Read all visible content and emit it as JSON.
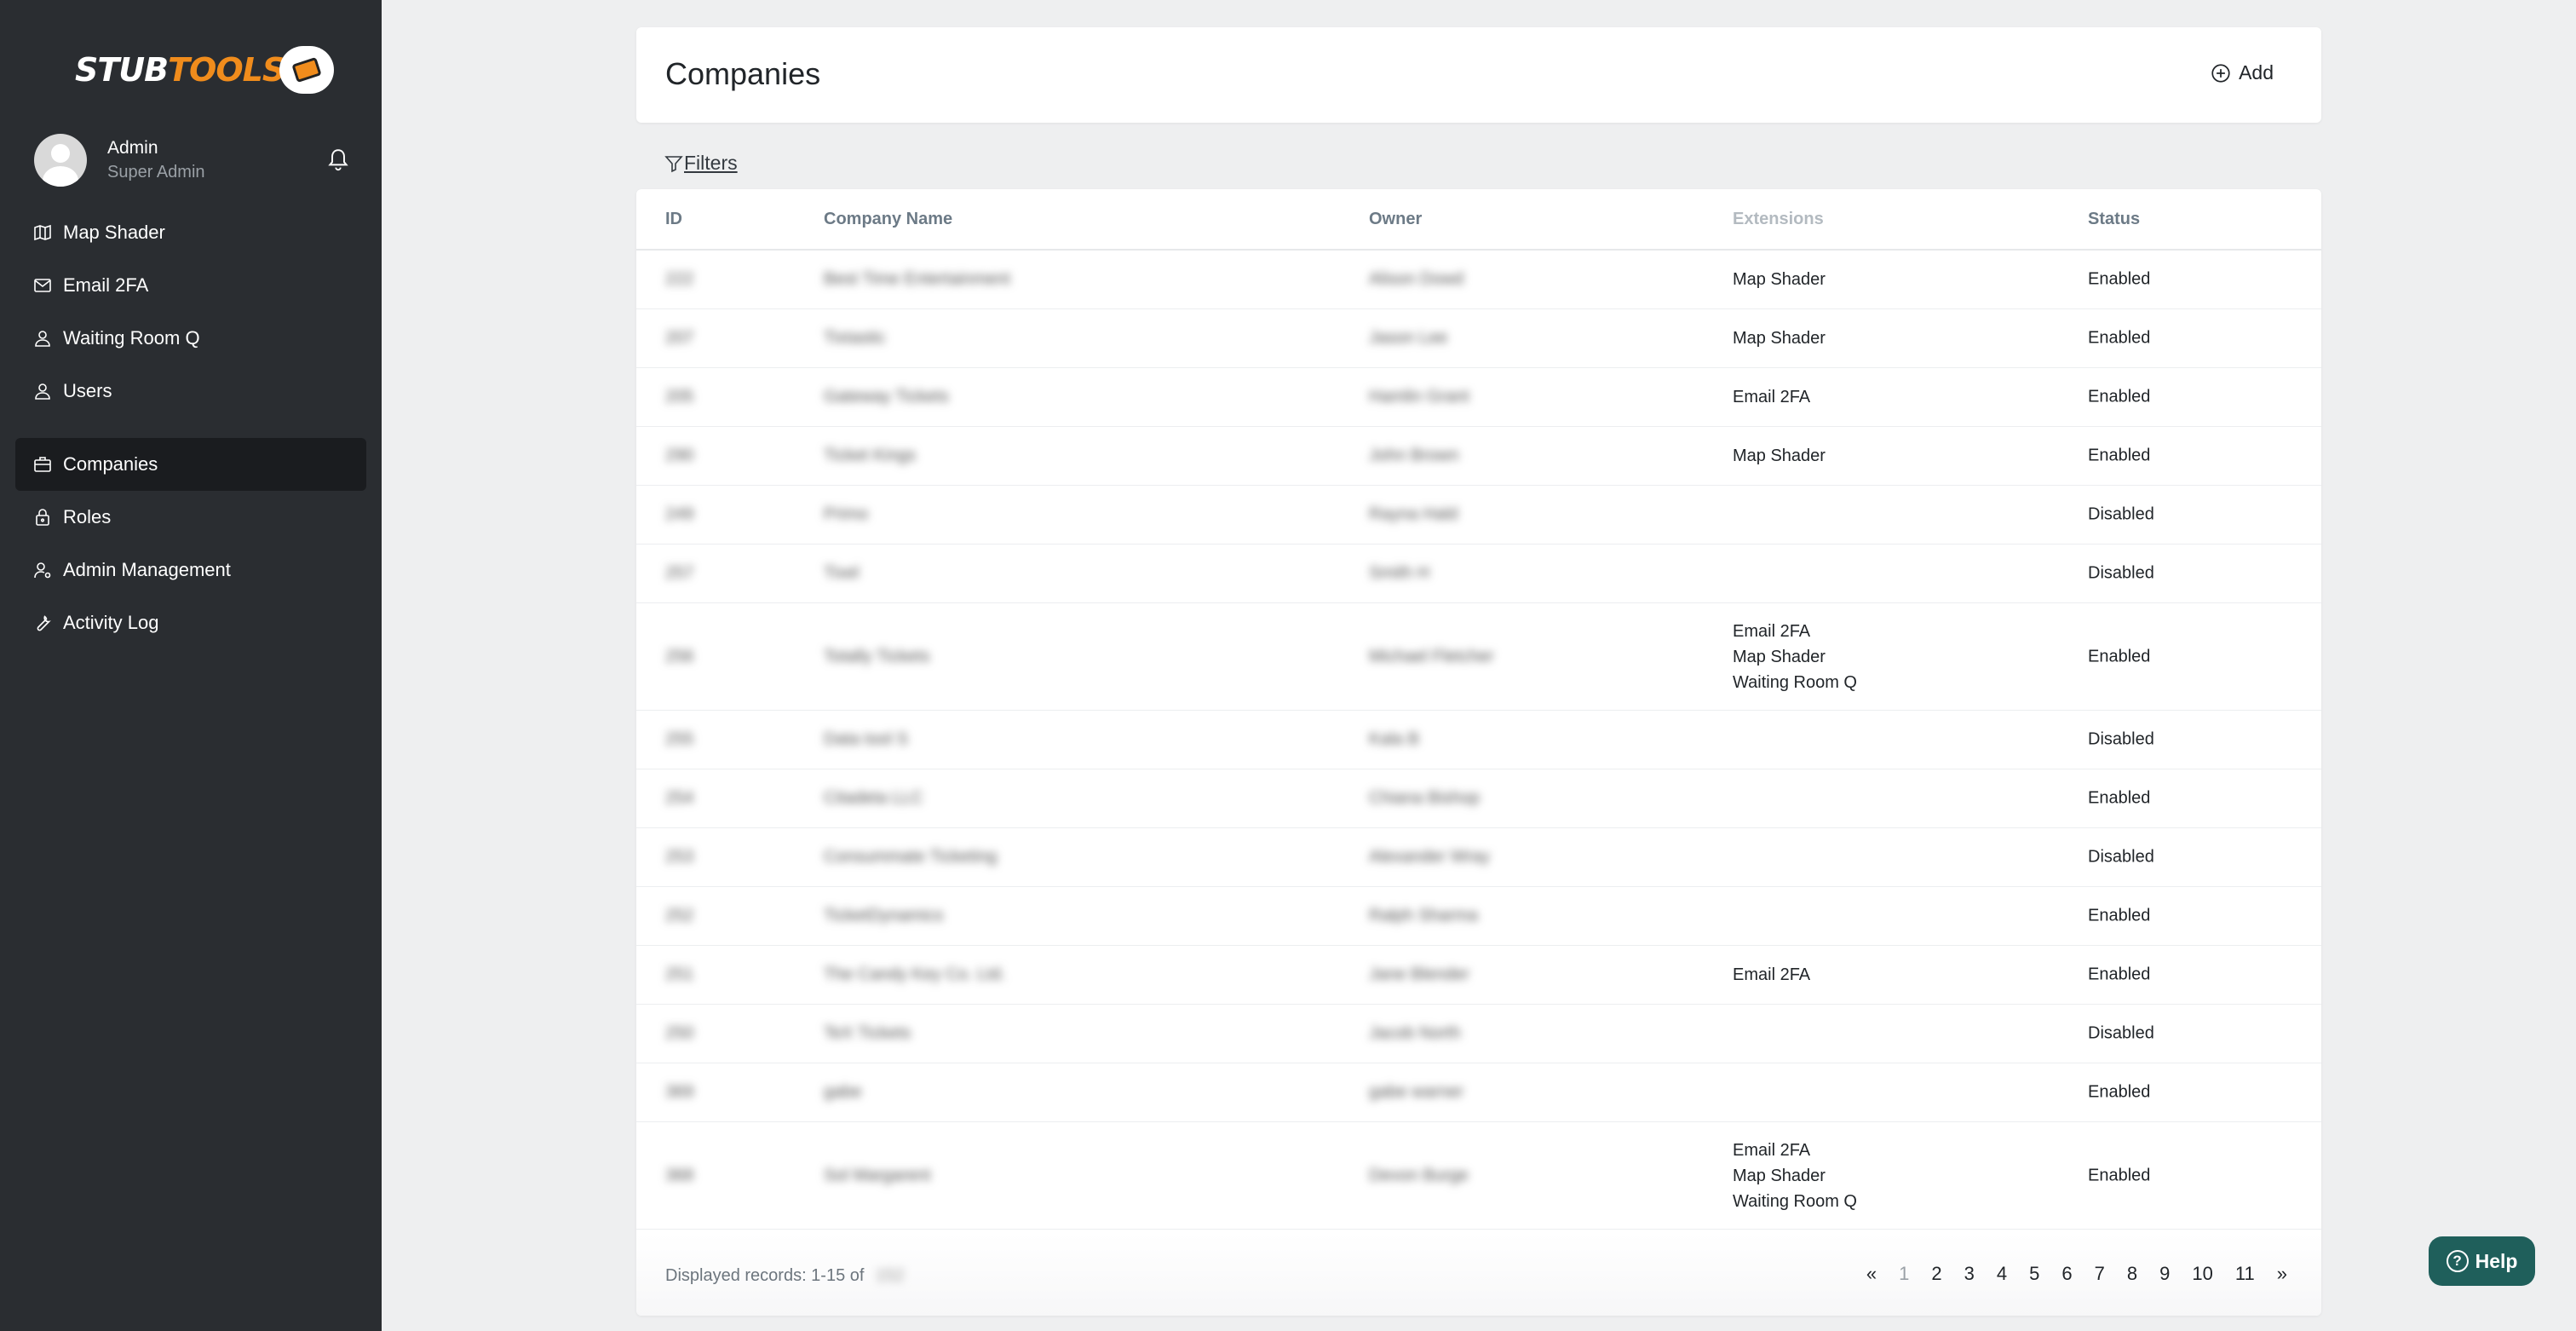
{
  "app": {
    "logo_part1": "STUB",
    "logo_part2": "TOOLS"
  },
  "profile": {
    "name": "Admin",
    "role": "Super Admin"
  },
  "sidebar": {
    "items": [
      {
        "label": "Map Shader",
        "icon": "map-icon"
      },
      {
        "label": "Email 2FA",
        "icon": "mail-icon"
      },
      {
        "label": "Waiting Room Q",
        "icon": "user-icon"
      },
      {
        "label": "Users",
        "icon": "user-icon"
      },
      {
        "label": "Companies",
        "icon": "briefcase-icon",
        "active": true
      },
      {
        "label": "Roles",
        "icon": "lock-icon"
      },
      {
        "label": "Admin Management",
        "icon": "user-cog-icon"
      },
      {
        "label": "Activity Log",
        "icon": "wrench-icon"
      }
    ]
  },
  "header": {
    "title": "Companies",
    "add_label": "Add"
  },
  "filters": {
    "label": "Filters"
  },
  "table": {
    "columns": [
      "ID",
      "Company Name",
      "Owner",
      "Extensions",
      "Status"
    ],
    "rows": [
      {
        "id": "222",
        "name": "Best Time Entertainment",
        "owner": "Alison Dowd",
        "extensions": [
          "Map Shader"
        ],
        "status": "Enabled"
      },
      {
        "id": "207",
        "name": "Tixtastic",
        "owner": "Jason Lee",
        "extensions": [
          "Map Shader"
        ],
        "status": "Enabled"
      },
      {
        "id": "205",
        "name": "Gateway Tickets",
        "owner": "Hamlin Grant",
        "extensions": [
          "Email 2FA"
        ],
        "status": "Enabled"
      },
      {
        "id": "290",
        "name": "Ticket Kings",
        "owner": "John Brown",
        "extensions": [
          "Map Shader"
        ],
        "status": "Enabled"
      },
      {
        "id": "249",
        "name": "Primo",
        "owner": "Rayna Hald",
        "extensions": [],
        "status": "Disabled"
      },
      {
        "id": "257",
        "name": "Tixel",
        "owner": "Smith H",
        "extensions": [],
        "status": "Disabled"
      },
      {
        "id": "256",
        "name": "Totally Tickets",
        "owner": "Michael Fletcher",
        "extensions": [
          "Email 2FA",
          "Map Shader",
          "Waiting Room Q"
        ],
        "status": "Enabled"
      },
      {
        "id": "255",
        "name": "Data tool S",
        "owner": "Kala B",
        "extensions": [],
        "status": "Disabled"
      },
      {
        "id": "254",
        "name": "Citadeta LLC",
        "owner": "Chiana Bishop",
        "extensions": [],
        "status": "Enabled"
      },
      {
        "id": "253",
        "name": "Consummate Ticketing",
        "owner": "Alexander Wray",
        "extensions": [],
        "status": "Disabled"
      },
      {
        "id": "252",
        "name": "TicketDynamics",
        "owner": "Ralph Sharma",
        "extensions": [],
        "status": "Enabled"
      },
      {
        "id": "251",
        "name": "The Candy Key Co. Ltd.",
        "owner": "Jane Blender",
        "extensions": [
          "Email 2FA"
        ],
        "status": "Enabled"
      },
      {
        "id": "250",
        "name": "TeX Tickets",
        "owner": "Jacob North",
        "extensions": [],
        "status": "Disabled"
      },
      {
        "id": "369",
        "name": "gabe",
        "owner": "gabe warner",
        "extensions": [],
        "status": "Enabled"
      },
      {
        "id": "368",
        "name": "Sol Margarent",
        "owner": "Devon Burge",
        "extensions": [
          "Email 2FA",
          "Map Shader",
          "Waiting Room Q"
        ],
        "status": "Enabled"
      }
    ]
  },
  "footer": {
    "records_label": "Displayed records: 1-15 of",
    "records_total": "152",
    "pager": {
      "prev": "«",
      "pages": [
        "1",
        "2",
        "3",
        "4",
        "5",
        "6",
        "7",
        "8",
        "9",
        "10",
        "11"
      ],
      "current": "1",
      "next": "»"
    }
  },
  "help": {
    "label": "Help",
    "icon": "question-icon"
  }
}
